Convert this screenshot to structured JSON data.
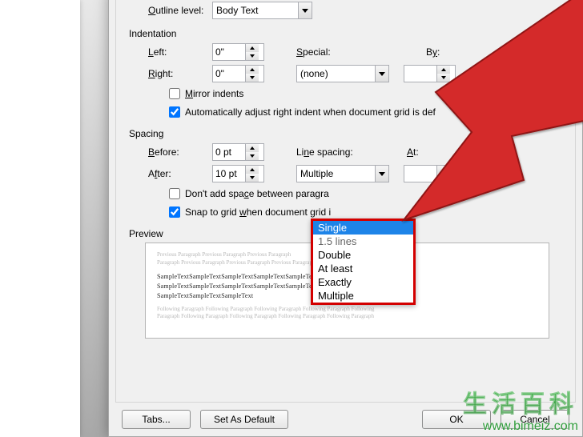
{
  "outline": {
    "label": "Outline level:",
    "value": "Body Text"
  },
  "indentation": {
    "title": "Indentation",
    "left_label": "Left:",
    "left_value": "0\"",
    "right_label": "Right:",
    "right_value": "0\"",
    "special_label": "Special:",
    "special_value": "(none)",
    "by_label": "By:",
    "by_value": "",
    "mirror_label": "Mirror indents",
    "mirror_checked": false,
    "auto_label": "Automatically adjust right indent when document grid is def",
    "auto_checked": true
  },
  "spacing": {
    "title": "Spacing",
    "before_label": "Before:",
    "before_value": "0 pt",
    "after_label": "After:",
    "after_value": "10 pt",
    "line_label": "Line spacing:",
    "line_value": "Multiple",
    "at_label": "At:",
    "at_value": "",
    "noadd_label": "Don't add space between paragra",
    "noadd_checked": false,
    "snap_label": "Snap to grid when document grid i",
    "snap_checked": true,
    "options": [
      "Single",
      "1.5 lines",
      "Double",
      "At least",
      "Exactly",
      "Multiple"
    ],
    "selected_option": "Single"
  },
  "preview": {
    "title": "Preview",
    "ghost1": "Previous Paragraph Previous Paragraph Previous Paragraph",
    "ghost2": "Paragraph Previous Paragraph Previous Paragraph Previous Paragraph Previous Paragraph",
    "sample1": "SampleTextSampleTextSampleTextSampleTextSampleTextSampleTextSampleTextSampleText",
    "sample2": "SampleTextSampleTextSampleTextSampleTextSampleTextSampleTextSampleTextSampleText",
    "sample3": "SampleTextSampleTextSampleText",
    "ghost3": "Following Paragraph Following Paragraph Following Paragraph Following Paragraph Following",
    "ghost4": "Paragraph Following Paragraph Following Paragraph Following Paragraph Following Paragraph"
  },
  "buttons": {
    "tabs": "Tabs...",
    "default": "Set As Default",
    "ok": "OK",
    "cancel": "Cancel"
  },
  "watermark": {
    "line1": "生活百科",
    "line2": "www.bimeiz.com"
  }
}
